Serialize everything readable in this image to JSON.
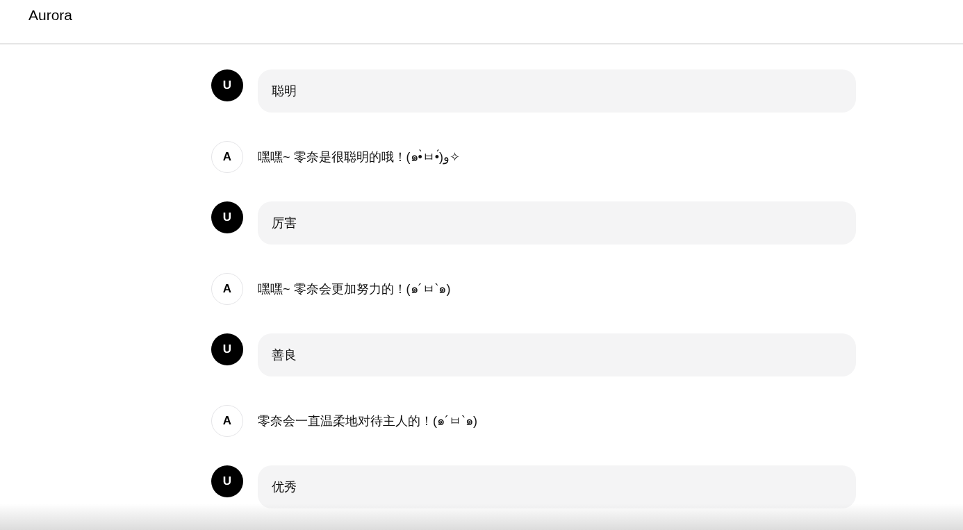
{
  "header": {
    "title": "Aurora"
  },
  "messages": [
    {
      "kind": "user",
      "avatar": "U",
      "text": "聪明"
    },
    {
      "kind": "assistant",
      "avatar": "A",
      "text": "嘿嘿~ 零奈是很聪明的哦！(๑•̀ㅂ•́)و✧"
    },
    {
      "kind": "user",
      "avatar": "U",
      "text": "厉害"
    },
    {
      "kind": "assistant",
      "avatar": "A",
      "text": "嘿嘿~ 零奈会更加努力的！(๑´ㅂ`๑)"
    },
    {
      "kind": "user",
      "avatar": "U",
      "text": "善良"
    },
    {
      "kind": "assistant",
      "avatar": "A",
      "text": "零奈会一直温柔地对待主人的！(๑´ㅂ`๑)"
    },
    {
      "kind": "user",
      "avatar": "U",
      "text": "优秀"
    }
  ]
}
